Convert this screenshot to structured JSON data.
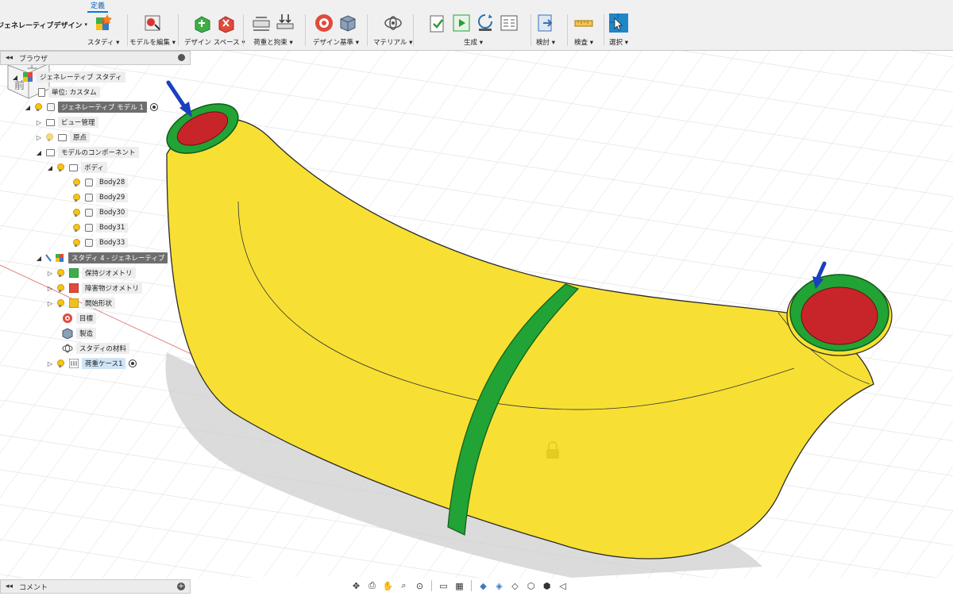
{
  "workspace": {
    "label": "ジェネレーティブデザイン",
    "caret": "▾"
  },
  "tab": {
    "label": "定義"
  },
  "toolbar": {
    "groups": [
      {
        "label": "スタディ ▾"
      },
      {
        "label": "モデルを編集 ▾"
      },
      {
        "label": "デザイン スペース ▾"
      },
      {
        "label": "荷重と拘束 ▾"
      },
      {
        "label": "デザイン基準 ▾"
      },
      {
        "label": "マテリアル ▾"
      },
      {
        "label": "生成 ▾"
      },
      {
        "label": "検討 ▾"
      },
      {
        "label": "検査 ▾"
      },
      {
        "label": "選択 ▾"
      }
    ]
  },
  "browser": {
    "title": "ブラウザ",
    "items": [
      {
        "label": "ジェネレーティブ スタディ"
      },
      {
        "label": "単位: カスタム"
      },
      {
        "label": "ジェネレーティブ モデル 1"
      },
      {
        "label": "ビュー管理"
      },
      {
        "label": "原点"
      },
      {
        "label": "モデルのコンポーネント"
      },
      {
        "label": "ボディ"
      },
      {
        "label": "Body28"
      },
      {
        "label": "Body29"
      },
      {
        "label": "Body30"
      },
      {
        "label": "Body31"
      },
      {
        "label": "Body33"
      },
      {
        "label": "スタディ 4 - ジェネレーティブ"
      },
      {
        "label": "保持ジオメトリ"
      },
      {
        "label": "障害物ジオメトリ"
      },
      {
        "label": "開始形状"
      },
      {
        "label": "目標"
      },
      {
        "label": "製造"
      },
      {
        "label": "スタディの材料"
      },
      {
        "label": "荷重ケース1"
      }
    ]
  },
  "viewcube": {
    "top": "上",
    "front": "前",
    "x": "X",
    "z": "Z"
  },
  "comments": {
    "title": "コメント"
  },
  "colors": {
    "body": "#f7e033",
    "preserve": "#22a335",
    "obstacle": "#c8252b",
    "load": "#1a3fbf",
    "accent": "#0a78d7"
  },
  "navbar": {
    "icons": [
      "orbit-icon",
      "look-at-icon",
      "pan-icon",
      "zoom-icon",
      "fit-icon",
      "display-settings-icon",
      "grid-icon",
      "shaded-icon",
      "shaded-edges-icon",
      "wireframe-icon",
      "hidden-edges-icon",
      "visible-edges-icon",
      "perspective-icon"
    ]
  }
}
